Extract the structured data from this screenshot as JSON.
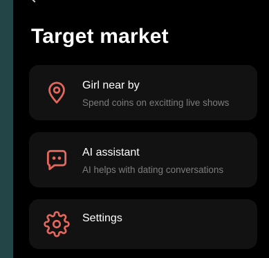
{
  "page": {
    "title": "Target market"
  },
  "menu": {
    "items": [
      {
        "label": "Girl near by",
        "description": "Spend coins on excitting live shows",
        "icon": "location-pin-icon"
      },
      {
        "label": "AI assistant",
        "description": "AI helps with dating conversations",
        "icon": "chat-bubble-icon"
      },
      {
        "label": "Settings",
        "description": "",
        "icon": "gear-icon"
      }
    ]
  },
  "colors": {
    "accent": "#e5685d",
    "background": "#000000",
    "card": "#121212",
    "outer": "#244548"
  }
}
